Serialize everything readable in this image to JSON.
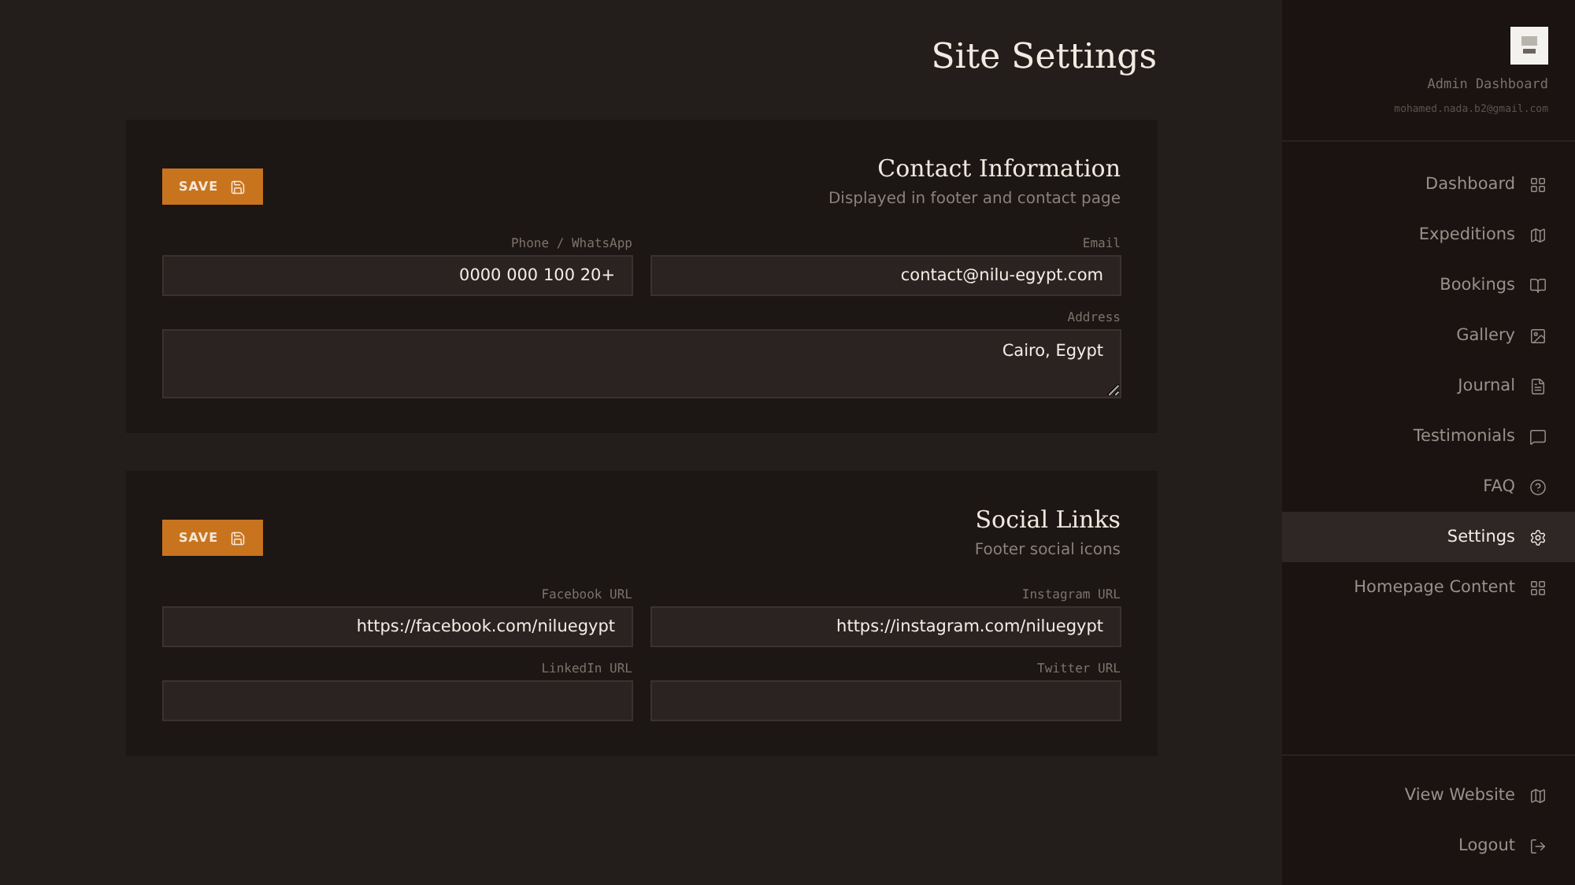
{
  "page": {
    "title": "Site Settings"
  },
  "sections": [
    {
      "title": "Contact Information",
      "subtitle": "Displayed in footer and contact page",
      "save_label": "SAVE",
      "fields": [
        {
          "kind": "input",
          "label": "Phone / WhatsApp",
          "value": "0000 000 100 20+"
        },
        {
          "kind": "input",
          "label": "Email",
          "value": "contact@nilu-egypt.com"
        },
        {
          "kind": "textarea",
          "label": "Address",
          "value": "Cairo, Egypt"
        }
      ]
    },
    {
      "title": "Social Links",
      "subtitle": "Footer social icons",
      "save_label": "SAVE",
      "fields": [
        {
          "kind": "input",
          "label": "Facebook URL",
          "value": "https://facebook.com/niluegypt"
        },
        {
          "kind": "input",
          "label": "Instagram URL",
          "value": "https://instagram.com/niluegypt"
        },
        {
          "kind": "input",
          "label": "LinkedIn URL"
        },
        {
          "kind": "input",
          "label": "Twitter URL"
        }
      ]
    }
  ],
  "sidebar": {
    "title": "Admin Dashboard",
    "email": "mohamed.nada.b2@gmail.com",
    "items": [
      {
        "label": "Dashboard",
        "selected": false
      },
      {
        "label": "Expeditions",
        "selected": false
      },
      {
        "label": "Bookings",
        "selected": false
      },
      {
        "label": "Gallery",
        "selected": false
      },
      {
        "label": "Journal",
        "selected": false
      },
      {
        "label": "Testimonials",
        "selected": false
      },
      {
        "label": "FAQ",
        "selected": false
      },
      {
        "label": "Settings",
        "selected": true
      },
      {
        "label": "Homepage Content",
        "selected": false
      }
    ],
    "footer_items": [
      {
        "label": "View Website"
      },
      {
        "label": "Logout"
      }
    ]
  }
}
